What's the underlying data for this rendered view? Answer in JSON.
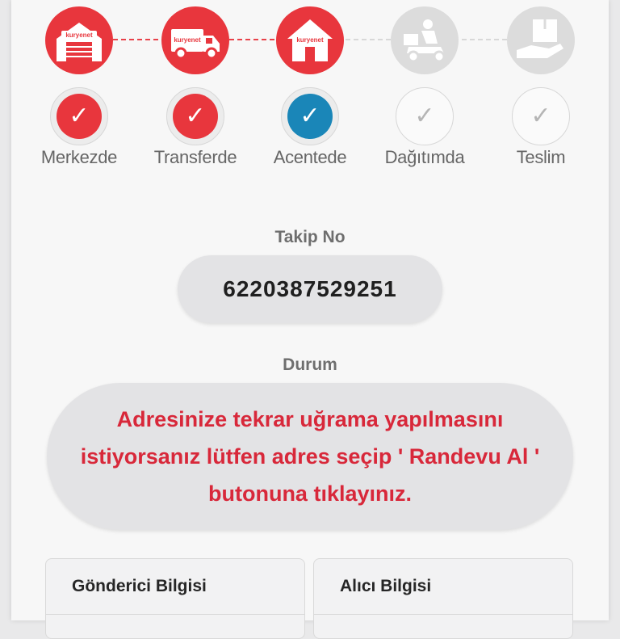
{
  "tracker": {
    "steps": [
      {
        "label": "Merkezde",
        "state": "done",
        "icon": "warehouse-icon",
        "brand": "kuryenet"
      },
      {
        "label": "Transferde",
        "state": "done",
        "icon": "truck-icon",
        "brand": "kuryenet"
      },
      {
        "label": "Acentede",
        "state": "active",
        "icon": "house-icon",
        "brand": "kuryenet"
      },
      {
        "label": "Dağıtımda",
        "state": "pending",
        "icon": "courier-scooter-icon"
      },
      {
        "label": "Teslim",
        "state": "pending",
        "icon": "package-hand-icon"
      }
    ],
    "check_glyph": "✓"
  },
  "tracking": {
    "label": "Takip No",
    "number": "6220387529251"
  },
  "status": {
    "label": "Durum",
    "message": "Adresinize tekrar uğrama yapılmasını istiyorsanız lütfen adres seçip ' Randevu Al ' butonuna tıklayınız."
  },
  "panels": {
    "sender": "Gönderici Bilgisi",
    "receiver": "Alıcı Bilgisi"
  },
  "colors": {
    "brand_red": "#e8363d",
    "active_blue": "#1a86b8",
    "status_text": "#d8283a",
    "inactive": "#dcdcdc"
  }
}
